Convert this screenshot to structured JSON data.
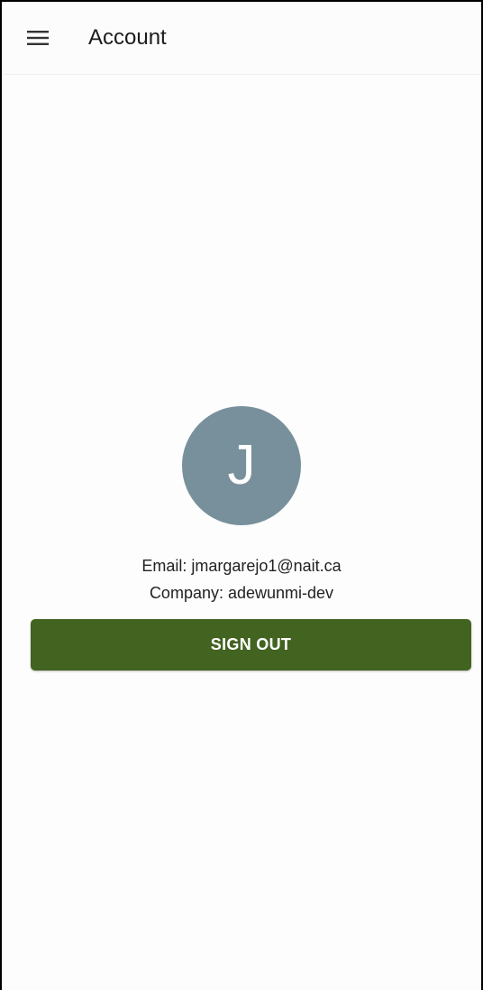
{
  "app_bar": {
    "menu_icon": "hamburger-menu-icon",
    "title": "Account"
  },
  "profile": {
    "avatar_initial": "J",
    "avatar_color": "#78909c",
    "email_line": "Email: jmargarejo1@nait.ca",
    "company_line": "Company: adewunmi-dev"
  },
  "actions": {
    "sign_out_label": "SIGN OUT",
    "sign_out_color": "#436321"
  }
}
